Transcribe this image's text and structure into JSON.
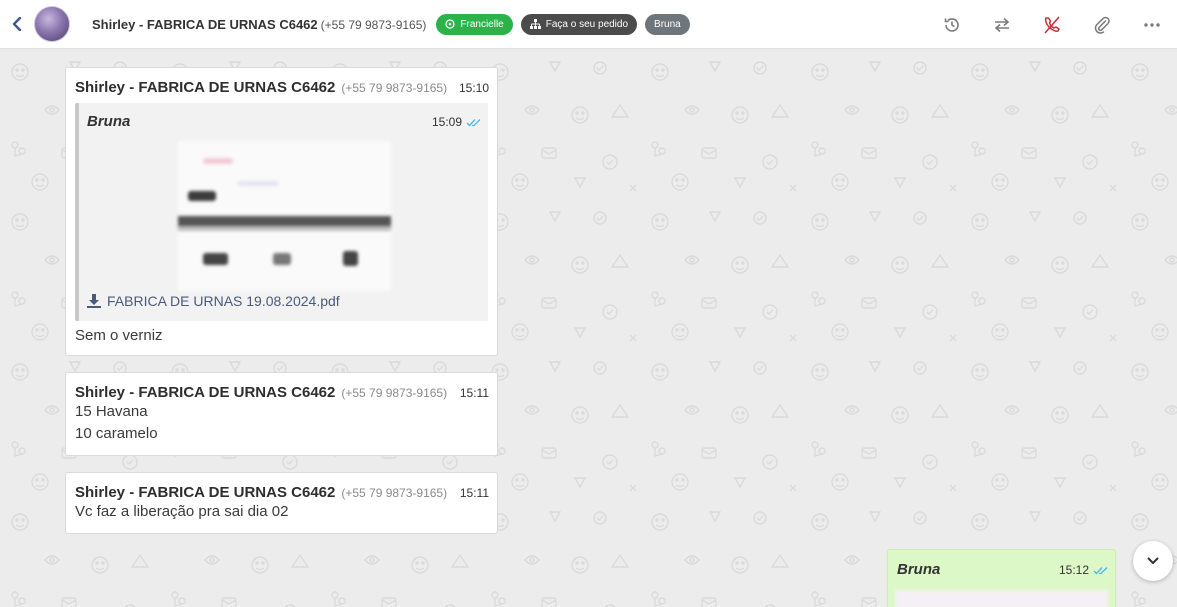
{
  "header": {
    "contact_name": "Shirley - FABRICA DE URNAS C6462",
    "contact_phone": "(+55 79 9873-9165)",
    "tags": [
      {
        "label": "Francielle",
        "icon": "whatsapp-icon",
        "color": "#2bb34a"
      },
      {
        "label": "Faça o seu pedido",
        "icon": "sitemap-icon",
        "color": "#4b4b4b"
      },
      {
        "label": "Bruna",
        "icon": "",
        "color": "#6e767c"
      }
    ],
    "actions": [
      "history-icon",
      "transfer-icon",
      "end-call-icon",
      "attach-icon",
      "more-icon"
    ]
  },
  "messages": [
    {
      "sender": "Shirley - FABRICA DE URNAS C6462",
      "phone": "(+55 79 9873-9165)",
      "time": "15:10",
      "quote": {
        "author": "Bruna",
        "time": "15:09",
        "file_name": "FABRICA DE URNAS 19.08.2024.pdf"
      },
      "text": "Sem o verniz"
    },
    {
      "sender": "Shirley - FABRICA DE URNAS C6462",
      "phone": "(+55 79 9873-9165)",
      "time": "15:11",
      "lines": [
        "15 Havana",
        "10 caramelo"
      ]
    },
    {
      "sender": "Shirley - FABRICA DE URNAS C6462",
      "phone": "(+55 79 9873-9165)",
      "time": "15:11",
      "text": "Vc faz a liberação pra sai dia 02"
    }
  ],
  "outgoing": {
    "author": "Bruna",
    "time": "15:12"
  },
  "colors": {
    "accent_green": "#2bb34a",
    "outgoing_bubble": "#dcf8c6",
    "read_tick": "#4fb6ec",
    "end_call": "#c62f3a"
  }
}
